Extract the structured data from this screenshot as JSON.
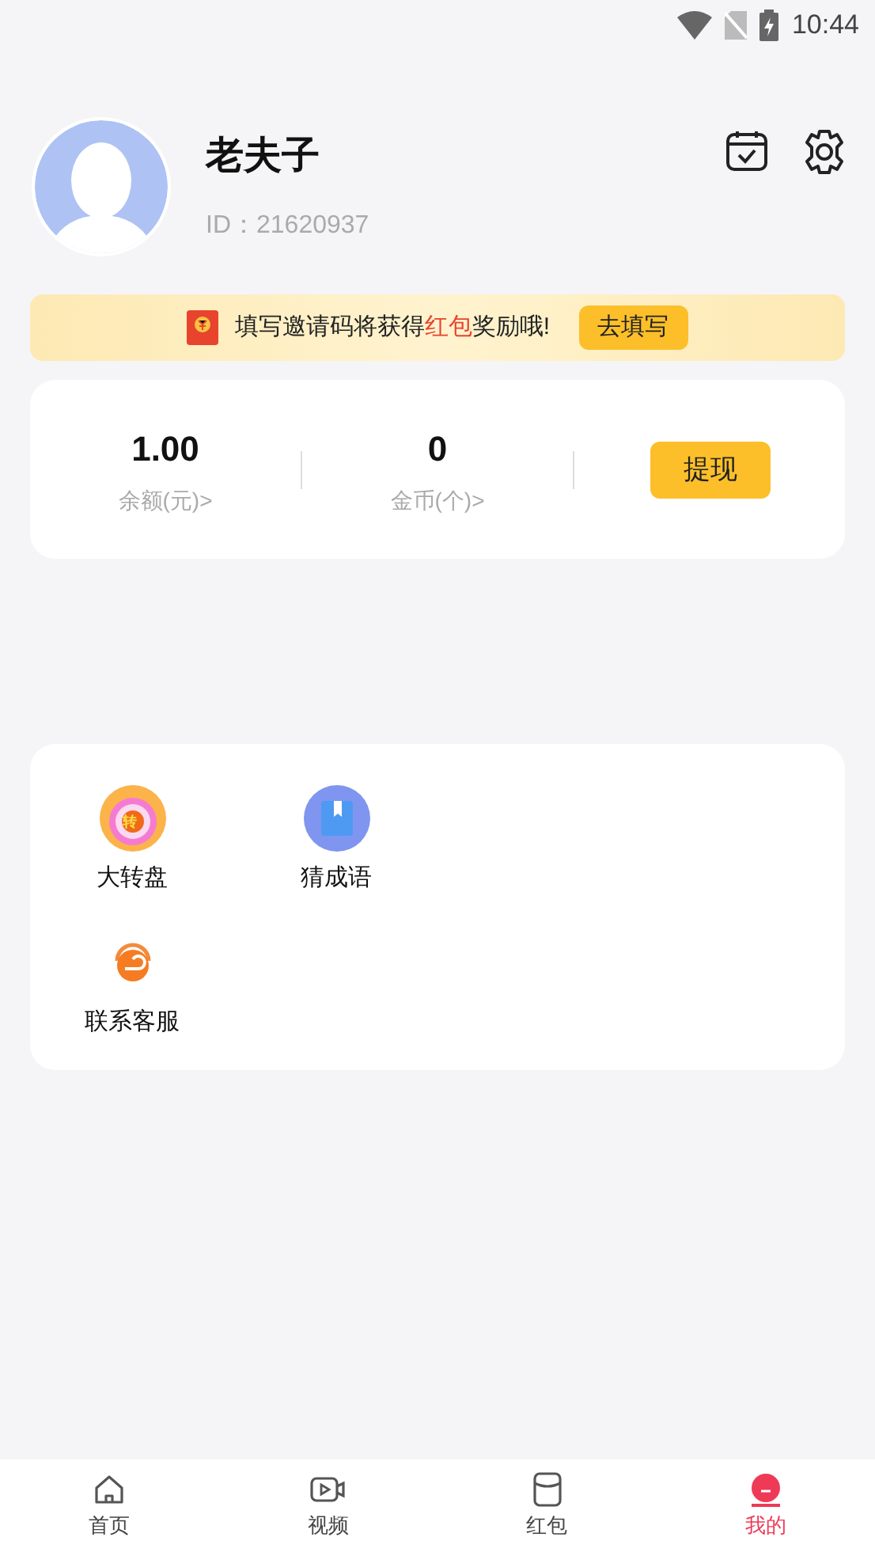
{
  "status_bar": {
    "time": "10:44"
  },
  "profile": {
    "name": "老夫子",
    "id": "ID：21620937"
  },
  "invite_banner": {
    "text_before": "填写邀请码将获得",
    "highlight": "红包",
    "text_after": "奖励哦!",
    "button": "去填写"
  },
  "wallet": {
    "stats": [
      {
        "value": "1.00",
        "label": "余额(元)>"
      },
      {
        "value": "0",
        "label": "金币(个)>"
      }
    ],
    "button": "提现"
  },
  "tools": [
    {
      "kind": "wheel",
      "label": "大转盘",
      "badge": "转"
    },
    {
      "kind": "book",
      "label": "猜成语"
    },
    {
      "kind": "headset",
      "label": "联系客服"
    }
  ],
  "tab_bar": [
    {
      "kind": "home",
      "label": "首页",
      "selected": false
    },
    {
      "kind": "video",
      "label": "视频",
      "selected": false
    },
    {
      "kind": "packet",
      "label": "红包",
      "selected": false
    },
    {
      "kind": "me",
      "label": "我的",
      "selected": true
    }
  ]
}
